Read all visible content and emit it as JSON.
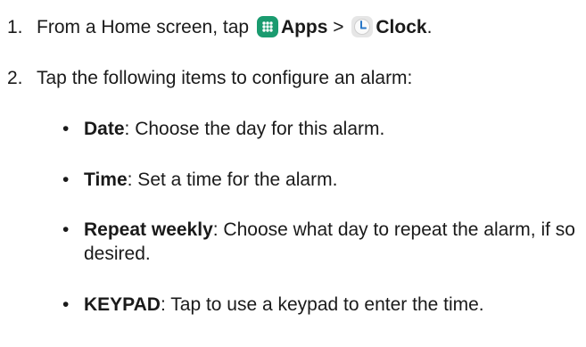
{
  "steps": [
    {
      "number": "1.",
      "text_before": "From a Home screen, tap",
      "apps_icon": "apps-grid-icon",
      "apps_label": "Apps",
      "separator": ">",
      "clock_icon": "clock-icon",
      "clock_label": "Clock",
      "end": "."
    },
    {
      "number": "2.",
      "text": "Tap the following items to configure an alarm:"
    }
  ],
  "bullets": [
    {
      "term": "Date",
      "desc": ": Choose the day for this alarm."
    },
    {
      "term": "Time",
      "desc": ": Set a time for the alarm."
    },
    {
      "term": "Repeat weekly",
      "desc": ": Choose what day to repeat the alarm, if so desired."
    },
    {
      "term": "KEYPAD",
      "desc": ": Tap to use a keypad to enter the time."
    }
  ],
  "colors": {
    "text": "#1a1a1a",
    "apps_icon_bg": "#1a9b6f",
    "clock_icon_bg": "#e6e6e6"
  }
}
